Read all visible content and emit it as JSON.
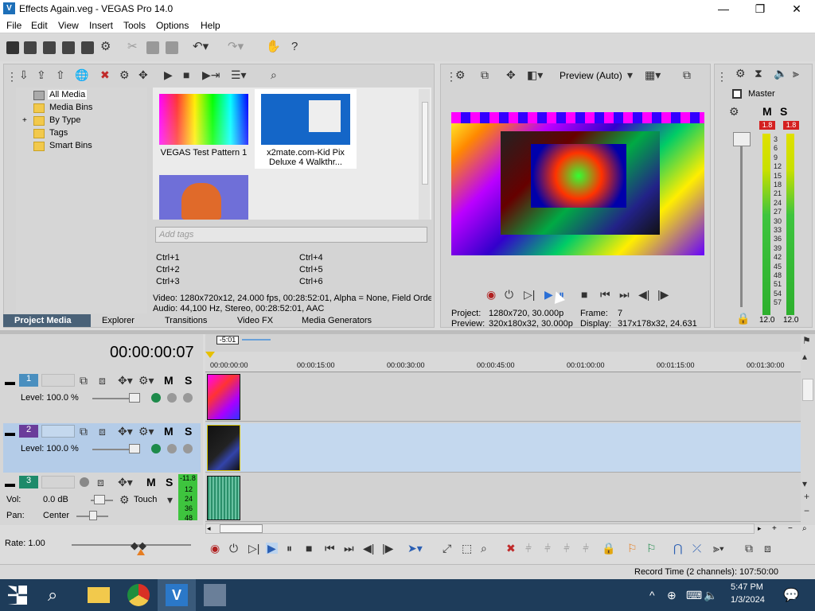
{
  "window": {
    "title": "Effects Again.veg - VEGAS Pro 14.0",
    "app_icon": "V",
    "minimize": "—",
    "maximize": "❐",
    "close": "✕"
  },
  "menu": [
    "File",
    "Edit",
    "View",
    "Insert",
    "Tools",
    "Options",
    "Help"
  ],
  "explorer": {
    "tree": [
      "All Media",
      "Media Bins",
      "By Type",
      "Tags",
      "Smart Bins"
    ],
    "expand_glyph": "+",
    "media": [
      {
        "caption": "VEGAS Test Pattern 1"
      },
      {
        "caption": "x2mate.com-Kid Pix Deluxe 4 Walkthr..."
      },
      {
        "caption": ""
      }
    ],
    "tags_placeholder": "Add tags",
    "shortcuts": [
      "Ctrl+1",
      "Ctrl+2",
      "Ctrl+3",
      "Ctrl+4",
      "Ctrl+5",
      "Ctrl+6"
    ],
    "video_info": "Video: 1280x720x12, 24.000 fps, 00:28:52:01, Alpha = None, Field Orde",
    "audio_info": "Audio: 44,100 Hz, Stereo, 00:28:52:01, AAC",
    "tabs": [
      "Project Media",
      "Explorer",
      "Transitions",
      "Video FX",
      "Media Generators"
    ]
  },
  "preview": {
    "mode": "Preview (Auto)",
    "project_label": "Project:",
    "project_value": "1280x720, 30.000p",
    "preview_label": "Preview:",
    "preview_value": "320x180x32, 30.000p",
    "frame_label": "Frame:",
    "frame_value": "7",
    "display_label": "Display:",
    "display_value": "317x178x32, 24.631"
  },
  "master": {
    "title": "Master",
    "mute": "M",
    "solo": "S",
    "peak_left": "1.8",
    "peak_right": "1.8",
    "scale": [
      "3",
      "6",
      "9",
      "12",
      "15",
      "18",
      "21",
      "24",
      "27",
      "30",
      "33",
      "36",
      "39",
      "42",
      "45",
      "48",
      "51",
      "54",
      "57"
    ],
    "level_left": "12.0",
    "level_right": "12.0"
  },
  "timeline": {
    "timecode": "00:00:00:07",
    "cursor_label": "-5:01",
    "ruler": [
      "00:00:00:00",
      "00:00:15:00",
      "00:00:30:00",
      "00:00:45:00",
      "00:01:00:00",
      "00:01:15:00",
      "00:01:30:00"
    ],
    "tracks": [
      {
        "number": "1",
        "level": "Level: 100.0 %",
        "mute": "M",
        "solo": "S"
      },
      {
        "number": "2",
        "level": "Level: 100.0 %",
        "mute": "M",
        "solo": "S"
      },
      {
        "number": "3",
        "vol_label": "Vol:",
        "vol_value": "0.0 dB",
        "pan_label": "Pan:",
        "pan_value": "Center",
        "automation": "Touch",
        "mute": "M",
        "solo": "S",
        "meter": [
          "-11.8",
          "12",
          "24",
          "36",
          "48"
        ]
      }
    ],
    "rate": "Rate: 1.00"
  },
  "status": {
    "record_time": "Record Time (2 channels): 107:50:00"
  },
  "taskbar": {
    "time": "5:47 PM",
    "date": "1/3/2024",
    "notifications": "1"
  }
}
